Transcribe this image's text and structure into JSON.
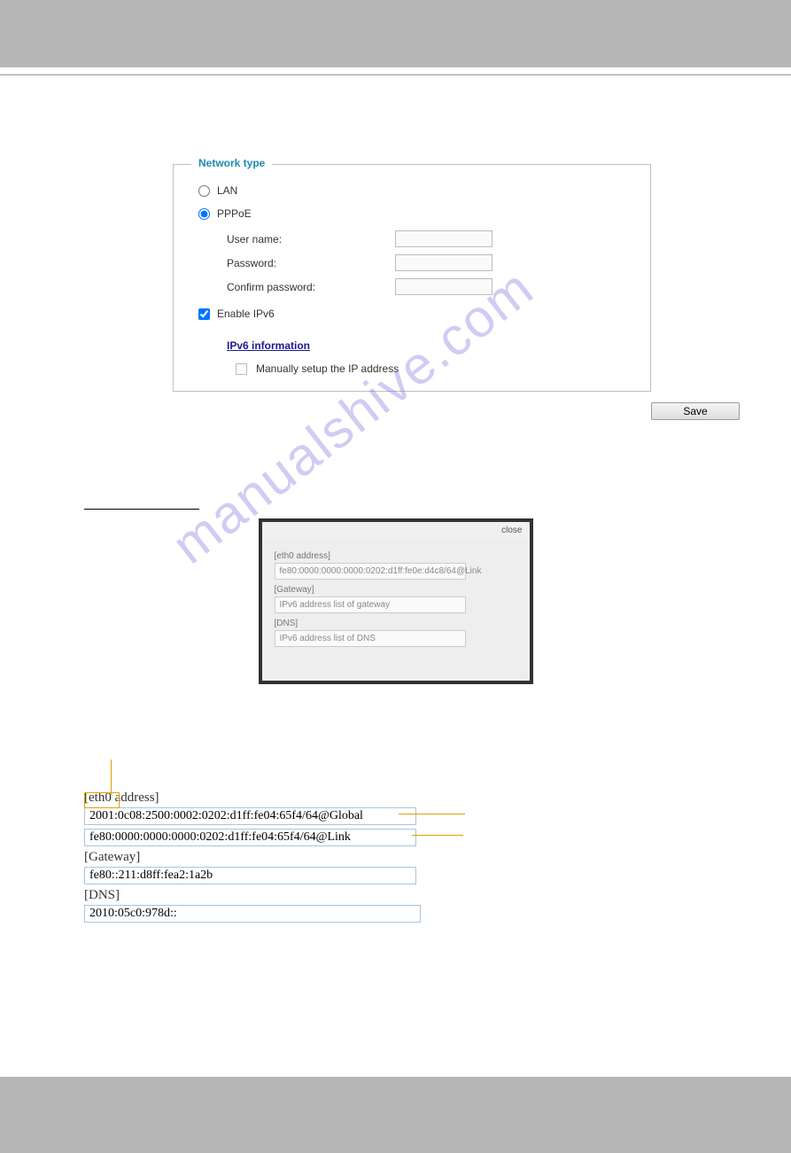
{
  "fieldset": {
    "legend": "Network type",
    "lan_label": "LAN",
    "pppoe_label": "PPPoE",
    "username_label": "User name:",
    "password_label": "Password:",
    "confirm_label": "Confirm password:",
    "enable_ipv6_label": "Enable IPv6",
    "ipv6_info_link": "IPv6 information",
    "manual_label": "Manually setup the IP address"
  },
  "save_button": "Save",
  "popup": {
    "close": "close",
    "eth0": "[eth0 address]",
    "eth0_val": "fe80:0000:0000:0000:0202:d1ff:fe0e:d4c8/64@Link",
    "gateway": "[Gateway]",
    "gateway_val": "IPv6 address list of gateway",
    "dns": "[DNS]",
    "dns_val": "IPv6 address list of DNS"
  },
  "detail": {
    "eth0_label": "[eth0 address]",
    "addr_global": "2001:0c08:2500:0002:0202:d1ff:fe04:65f4/64@Global",
    "addr_link": "fe80:0000:0000:0000:0202:d1ff:fe04:65f4/64@Link",
    "gateway_label": "[Gateway]",
    "gateway_val": "fe80::211:d8ff:fea2:1a2b",
    "dns_label": "[DNS]",
    "dns_val": "2010:05c0:978d::"
  },
  "watermark": "manualshive.com"
}
